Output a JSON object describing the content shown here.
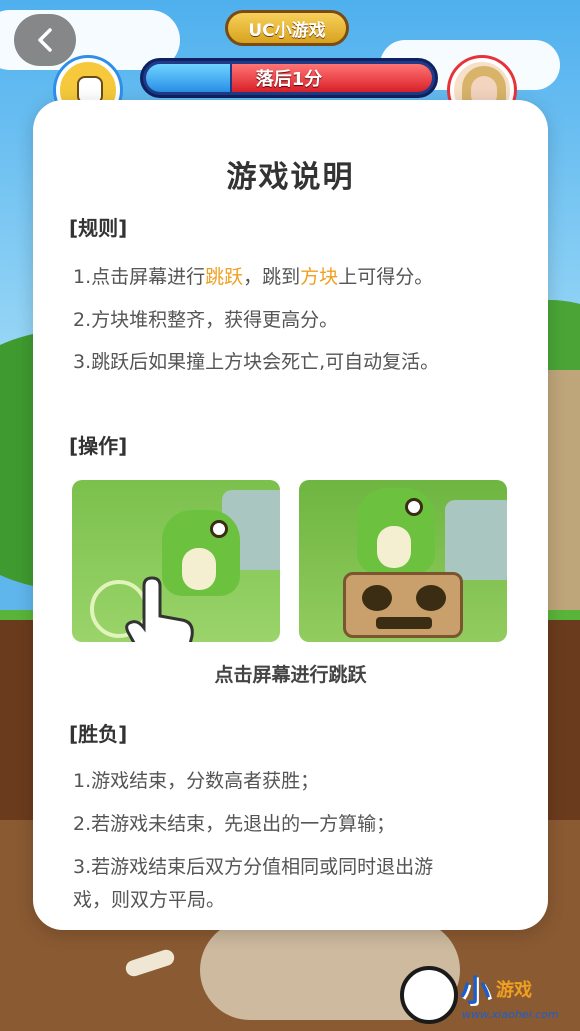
{
  "header": {
    "back_icon": "chevron-left-icon",
    "app_title": "UC小游戏",
    "score_status": "落后1分",
    "colors": {
      "player_bar": "#2a8fe6",
      "opponent_bar": "#d9202a",
      "title_pill": "#e2b02c"
    }
  },
  "dialog": {
    "title": "游戏说明",
    "rules": {
      "heading": "[规则]",
      "line1_prefix": "1.点击屏幕进行",
      "line1_hl1": "跳跃",
      "line1_mid": "，跳到",
      "line1_hl2": "方块",
      "line1_suffix": "上可得分。",
      "line2": "2.方块堆积整齐，获得更高分。",
      "line3": "3.跳跃后如果撞上方块会死亡,可自动复活。",
      "highlight_color": "#f0a020"
    },
    "controls": {
      "heading": "[操作]",
      "caption": "点击屏幕进行跳跃"
    },
    "outcome": {
      "heading": "[胜负]",
      "line1": "1.游戏结束，分数高者获胜；",
      "line2": "2.若游戏未结束，先退出的一方算输；",
      "line3a": "3.若游戏结束后双方分值相同或同时退出游",
      "line3b": "戏，则双方平局。"
    }
  },
  "watermark": {
    "brand": "小",
    "brand_sub": "游戏",
    "url": "www.xiaohei.com"
  }
}
